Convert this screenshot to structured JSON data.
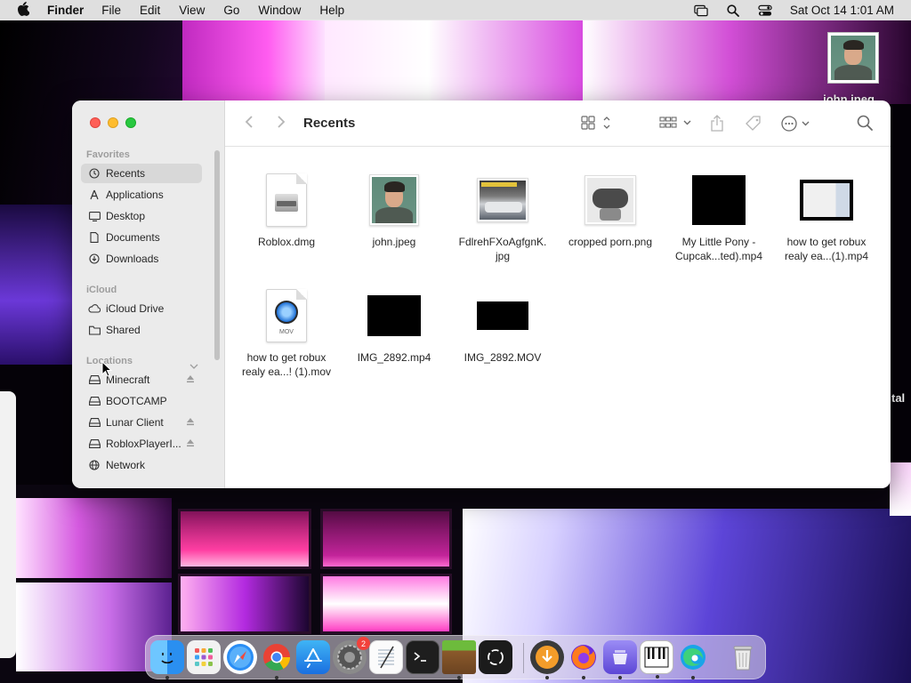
{
  "menubar": {
    "app_name": "Finder",
    "menus": [
      "File",
      "Edit",
      "View",
      "Go",
      "Window",
      "Help"
    ],
    "datetime": "Sat Oct 14  1:01 AM",
    "icons": [
      "apple-icon",
      "screen-mirroring-icon",
      "spotlight-search-icon",
      "control-center-icon"
    ]
  },
  "desktop": {
    "icon_label": "john.jpeg",
    "side_text": "tal"
  },
  "finder": {
    "title": "Recents",
    "sidebar": {
      "favorites_header": "Favorites",
      "favorites": [
        {
          "label": "Recents",
          "icon": "clock-icon",
          "active": true
        },
        {
          "label": "Applications",
          "icon": "applications-icon"
        },
        {
          "label": "Desktop",
          "icon": "desktop-icon"
        },
        {
          "label": "Documents",
          "icon": "document-icon"
        },
        {
          "label": "Downloads",
          "icon": "download-icon"
        }
      ],
      "icloud_header": "iCloud",
      "icloud": [
        {
          "label": "iCloud Drive",
          "icon": "cloud-icon"
        },
        {
          "label": "Shared",
          "icon": "shared-folder-icon"
        }
      ],
      "locations_header": "Locations",
      "locations": [
        {
          "label": "Minecraft",
          "icon": "drive-icon",
          "eject": true
        },
        {
          "label": "BOOTCAMP",
          "icon": "drive-icon",
          "eject": false
        },
        {
          "label": "Lunar Client",
          "icon": "drive-icon",
          "eject": true
        },
        {
          "label": "RobloxPlayerI...",
          "icon": "drive-icon",
          "eject": true
        },
        {
          "label": "Network",
          "icon": "globe-icon",
          "eject": false
        }
      ]
    },
    "files": [
      {
        "name": "Roblox.dmg",
        "kind": "dmg"
      },
      {
        "name": "john.jpeg",
        "kind": "portrait"
      },
      {
        "name": "FdlrehFXoAgfgnK.\njpg",
        "kind": "car"
      },
      {
        "name": "cropped porn.png",
        "kind": "controller"
      },
      {
        "name": "My Little Pony -\nCupcak...ted).mp4",
        "kind": "black"
      },
      {
        "name": "how to get robux\nrealy ea...(1).mp4",
        "kind": "screen"
      },
      {
        "name": "how to get robux\nrealy ea...! (1).mov",
        "kind": "mov"
      },
      {
        "name": "IMG_2892.mp4",
        "kind": "black-wide"
      },
      {
        "name": "IMG_2892.MOV",
        "kind": "black-wide"
      }
    ]
  },
  "dock": {
    "apps": [
      "finder-icon",
      "launchpad-icon",
      "safari-icon",
      "chrome-icon",
      "app-store-icon",
      "system-preferences-icon",
      "textedit-icon",
      "terminal-icon",
      "minecraft-icon",
      "chatgpt-icon",
      "downloader-icon",
      "firefox-icon",
      "stacks-icon",
      "piano-icon",
      "edge-icon",
      "trash-icon"
    ],
    "settings_badge": "2",
    "colors": {
      "accent": "#0a84ff"
    }
  }
}
